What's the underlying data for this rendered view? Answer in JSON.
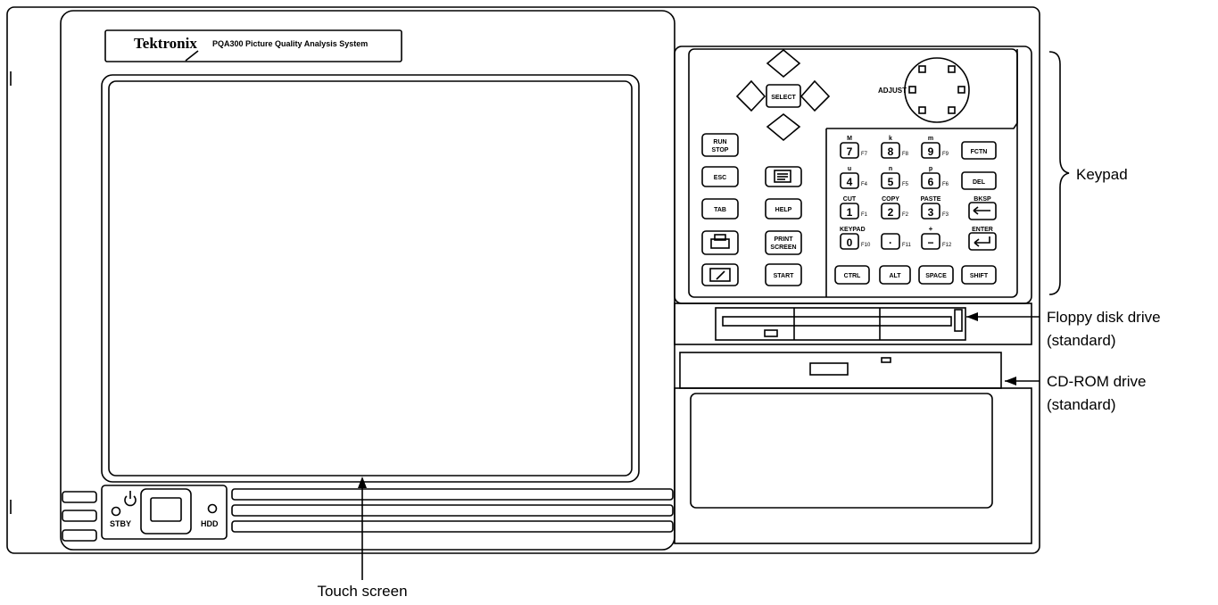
{
  "brand": {
    "logo_text": "Tektronix",
    "model_text": "PQA300 Picture Quality Analysis System"
  },
  "front_labels": {
    "standby": "STBY",
    "hdd": "HDD"
  },
  "keypad": {
    "select": "SELECT",
    "adjust": "ADJUST",
    "run_stop": [
      "RUN",
      "STOP"
    ],
    "esc": "ESC",
    "tab": "TAB",
    "help": "HELP",
    "print_screen": [
      "PRINT",
      "SCREEN"
    ],
    "start": "START",
    "fctn": "FCTN",
    "del": "DEL",
    "ctrl": "CTRL",
    "alt": "ALT",
    "space": "SPACE",
    "shift": "SHIFT",
    "cut": "CUT",
    "copy": "COPY",
    "paste": "PASTE",
    "bksp": "BKSP",
    "keypad_label": "KEYPAD",
    "enter": "ENTER",
    "prefix_m_upper": "M",
    "prefix_k": "k",
    "prefix_m_lower": "m",
    "prefix_u": "u",
    "prefix_n": "n",
    "prefix_p": "p",
    "plus": "+",
    "digit_7": "7",
    "digit_8": "8",
    "digit_9": "9",
    "digit_4": "4",
    "digit_5": "5",
    "digit_6": "6",
    "digit_1": "1",
    "digit_2": "2",
    "digit_3": "3",
    "digit_0": "0",
    "dot": "·",
    "minus": "−",
    "f1": "F1",
    "f2": "F2",
    "f3": "F3",
    "f4": "F4",
    "f5": "F5",
    "f6": "F6",
    "f7": "F7",
    "f8": "F8",
    "f9": "F9",
    "f10": "F10",
    "f11": "F11",
    "f12": "F12"
  },
  "callouts": {
    "keypad": "Keypad",
    "floppy_line1": "Floppy disk drive",
    "floppy_line2": "(standard)",
    "cdrom_line1": "CD-ROM drive",
    "cdrom_line2": "(standard)",
    "touch_screen": "Touch screen"
  }
}
